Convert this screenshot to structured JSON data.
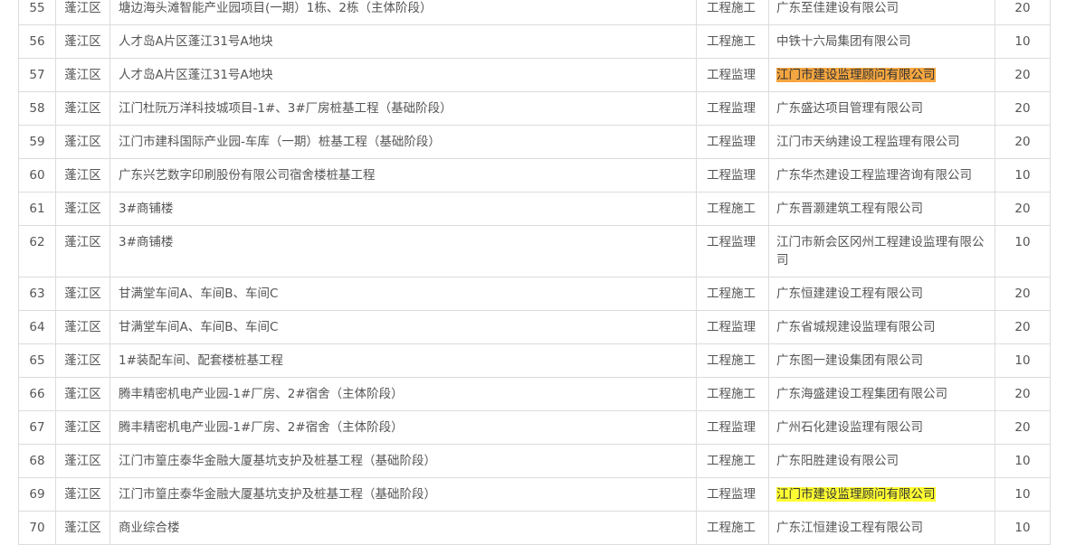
{
  "rows": [
    {
      "no": "55",
      "district": "蓬江区",
      "project": "塘边海头滩智能产业园项目(一期）1栋、2栋（主体阶段）",
      "type": "工程施工",
      "unit": "广东至佳建设有限公司",
      "score": "20",
      "highlight": ""
    },
    {
      "no": "56",
      "district": "蓬江区",
      "project": "人才岛A片区蓬江31号A地块",
      "type": "工程施工",
      "unit": "中铁十六局集团有限公司",
      "score": "10",
      "highlight": ""
    },
    {
      "no": "57",
      "district": "蓬江区",
      "project": "人才岛A片区蓬江31号A地块",
      "type": "工程监理",
      "unit": "江门市建设监理顾问有限公司",
      "score": "20",
      "highlight": "orange"
    },
    {
      "no": "58",
      "district": "蓬江区",
      "project": "江门杜阮万洋科技城项目-1#、3#厂房桩基工程（基础阶段）",
      "type": "工程监理",
      "unit": "广东盛达项目管理有限公司",
      "score": "20",
      "highlight": ""
    },
    {
      "no": "59",
      "district": "蓬江区",
      "project": "江门市建科国际产业园-车库（一期）桩基工程（基础阶段）",
      "type": "工程监理",
      "unit": "江门市天纳建设工程监理有限公司",
      "score": "20",
      "highlight": ""
    },
    {
      "no": "60",
      "district": "蓬江区",
      "project": "广东兴艺数字印刷股份有限公司宿舍楼桩基工程",
      "type": "工程监理",
      "unit": "广东华杰建设工程监理咨询有限公司",
      "score": "10",
      "highlight": ""
    },
    {
      "no": "61",
      "district": "蓬江区",
      "project": "3#商铺楼",
      "type": "工程施工",
      "unit": "广东晋灏建筑工程有限公司",
      "score": "20",
      "highlight": ""
    },
    {
      "no": "62",
      "district": "蓬江区",
      "project": "3#商铺楼",
      "type": "工程监理",
      "unit": "江门市新会区冈州工程建设监理有限公司",
      "score": "10",
      "highlight": ""
    },
    {
      "no": "63",
      "district": "蓬江区",
      "project": "甘满堂车间A、车间B、车间C",
      "type": "工程施工",
      "unit": "广东恒建建设工程有限公司",
      "score": "20",
      "highlight": ""
    },
    {
      "no": "64",
      "district": "蓬江区",
      "project": "甘满堂车间A、车间B、车间C",
      "type": "工程监理",
      "unit": "广东省城规建设监理有限公司",
      "score": "20",
      "highlight": ""
    },
    {
      "no": "65",
      "district": "蓬江区",
      "project": "1#装配车间、配套楼桩基工程",
      "type": "工程施工",
      "unit": "广东图一建设集团有限公司",
      "score": "10",
      "highlight": ""
    },
    {
      "no": "66",
      "district": "蓬江区",
      "project": "腾丰精密机电产业园-1#厂房、2#宿舍（主体阶段）",
      "type": "工程施工",
      "unit": "广东海盛建设工程集团有限公司",
      "score": "20",
      "highlight": ""
    },
    {
      "no": "67",
      "district": "蓬江区",
      "project": "腾丰精密机电产业园-1#厂房、2#宿舍（主体阶段）",
      "type": "工程监理",
      "unit": "广州石化建设监理有限公司",
      "score": "20",
      "highlight": ""
    },
    {
      "no": "68",
      "district": "蓬江区",
      "project": "江门市篁庄泰华金融大厦基坑支护及桩基工程（基础阶段）",
      "type": "工程施工",
      "unit": "广东阳胜建设有限公司",
      "score": "10",
      "highlight": ""
    },
    {
      "no": "69",
      "district": "蓬江区",
      "project": "江门市篁庄泰华金融大厦基坑支护及桩基工程（基础阶段）",
      "type": "工程监理",
      "unit": "江门市建设监理顾问有限公司",
      "score": "10",
      "highlight": "yellow"
    },
    {
      "no": "70",
      "district": "蓬江区",
      "project": "商业综合楼",
      "type": "工程施工",
      "unit": "广东江恒建设工程有限公司",
      "score": "10",
      "highlight": ""
    }
  ],
  "colors": {
    "text": "#555555",
    "border": "#dcdcdc",
    "highlight_orange": "#f5a640",
    "highlight_yellow": "#ffff33"
  }
}
